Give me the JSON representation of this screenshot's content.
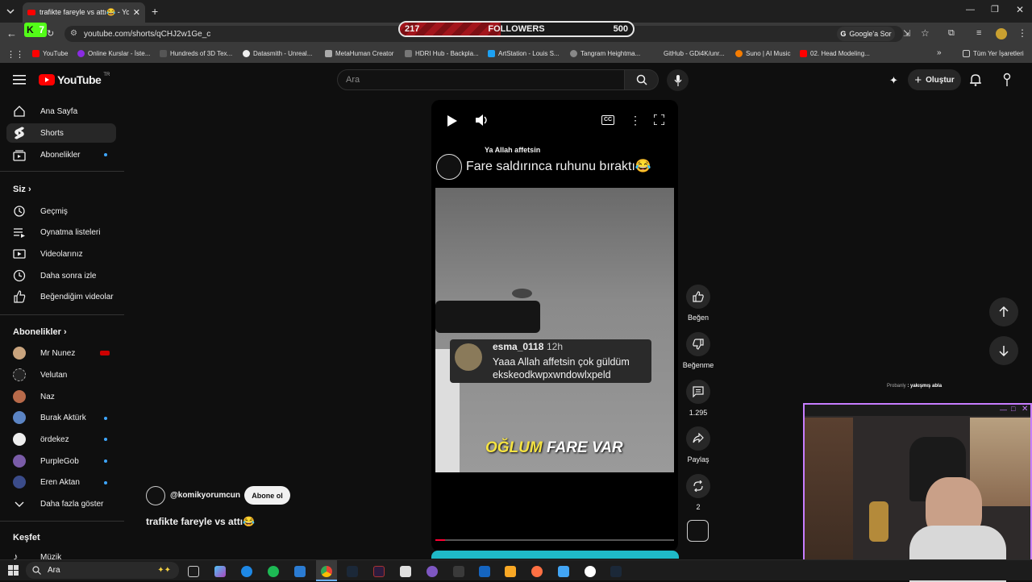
{
  "browser": {
    "tab_title": "trafikte fareyle vs attı😂 - YouTube",
    "url": "youtube.com/shorts/qCHJ2w1Ge_c",
    "google_button": "Google'a Sor",
    "kick_badge": "7",
    "bookmarks": [
      "YouTube",
      "Online Kurslar - İste...",
      "Hundreds of 3D Tex...",
      "Datasmith - Unreal...",
      "MetaHuman Creator",
      "HDRI Hub - Backpla...",
      "ArtStation - Louis S...",
      "Tangram Heightma...",
      "GitHub - GDi4K/unr...",
      "Suno | AI Music",
      "02. Head Modeling..."
    ],
    "all_bookmarks": "Tüm Yer İşaretleri"
  },
  "followers": {
    "current": "217",
    "label": "FOLLOWERS",
    "goal": "500",
    "progress": 0.434
  },
  "youtube": {
    "logo_text": "YouTube",
    "region": "TR",
    "search_placeholder": "Ara",
    "create_label": "Oluştur",
    "nav": [
      "Ana Sayfa",
      "Shorts",
      "Abonelikler"
    ],
    "you_header": "Siz",
    "you_items": [
      "Geçmiş",
      "Oynatma listeleri",
      "Videolarınız",
      "Daha sonra izle",
      "Beğendiğim videolar"
    ],
    "subs_header": "Abonelikler",
    "subs": [
      "Mr Nunez",
      "Velutan",
      "Naz",
      "Burak Aktürk",
      "ördekez",
      "PurpleGob",
      "Eren Aktan"
    ],
    "show_more": "Daha fazla göster",
    "explore_header": "Keşfet",
    "explore_items": [
      "Müzik"
    ]
  },
  "short": {
    "overlay_small": "Ya Allah affetsin",
    "overlay_title": "Fare saldırınca ruhunu bıraktı😂",
    "comment_user": "esma_0118",
    "comment_time": "12h",
    "comment_text_1": "Yaaa Allah affetsin çok güldüm",
    "comment_text_2": "ekskeodkwpxwndowlxpeld",
    "caption_prefix": "OĞLUM",
    "caption_rest": " FARE VAR",
    "channel": "@komikyorumcun",
    "subscribe": "Abone ol",
    "title": "trafikte fareyle vs attı😂",
    "like_label": "Beğen",
    "dislike_label": "Beğenme",
    "comments_count": "1.295",
    "share_label": "Paylaş",
    "remix_count": "2",
    "progress": 0.04
  },
  "stream": {
    "chat_user": "Probanly",
    "chat_text": ": yakışmış abla"
  },
  "taskbar": {
    "search_placeholder": "Ara"
  },
  "colors": {
    "youtube_red": "#ff0000",
    "accent_blue": "#3ea6ff",
    "kick_green": "#53fc18",
    "progress_red": "#ff0033"
  }
}
